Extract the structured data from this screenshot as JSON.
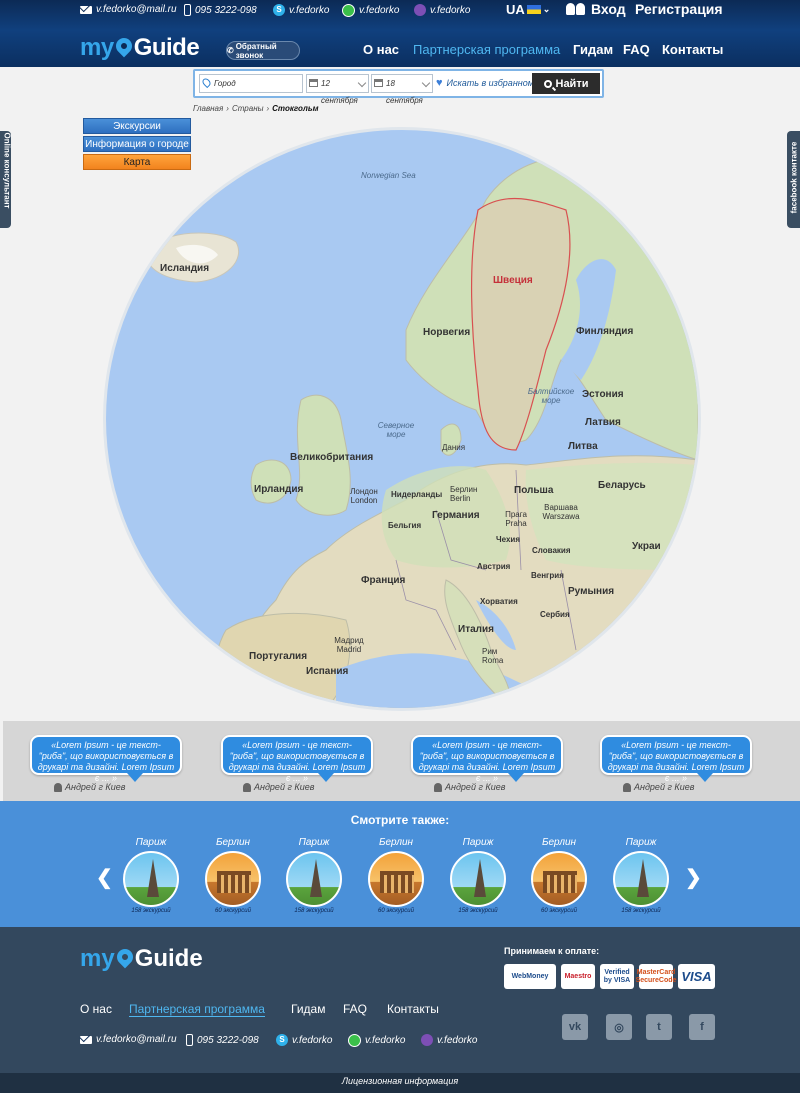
{
  "topbar": {
    "email": "v.fedorko@mail.ru",
    "phone": "095 3222-098",
    "skype": "v.fedorko",
    "whatsapp": "v.fedorko",
    "viber": "v.fedorko",
    "lang": "UA",
    "login": "Вход",
    "register": "Регистрация"
  },
  "header": {
    "logo_my": "my",
    "logo_guide": "Guide",
    "callback": "Обратный звонок",
    "nav": [
      "О нас",
      "Партнерская программа",
      "Гидам",
      "FAQ",
      "Контакты"
    ]
  },
  "search": {
    "city_placeholder": "Город",
    "date_from": "12 сентября",
    "date_to": "18 сентября",
    "favorites": "Искать в избранном",
    "find": "Найти"
  },
  "breadcrumb": [
    "Главная",
    "Страны",
    "Стокгольм"
  ],
  "side_menu": [
    "Экскурсии",
    "Информация о городе",
    "Карта"
  ],
  "side_tabs": {
    "left": "Online консультант",
    "right": "facebook  контакте"
  },
  "map": {
    "labels": {
      "norwegian_sea": "Norwegian Sea",
      "iceland": "Исландия",
      "sweden": "Швеция",
      "norway": "Норвегия",
      "finland": "Финляндия",
      "estonia": "Эстония",
      "baltic_sea": "Балтийское море",
      "latvia": "Латвия",
      "north_sea": "Северное море",
      "denmark": "Дания",
      "lithuania": "Литва",
      "uk": "Великобритания",
      "belarus": "Беларусь",
      "ireland": "Ирландия",
      "london": "Лондон London",
      "netherlands": "Нидерланды",
      "berlin": "Берлин Berlin",
      "poland": "Польша",
      "warsaw": "Варшава Warszawa",
      "belgium": "Бельгия",
      "germany": "Германия",
      "prague": "Прага Praha",
      "czech": "Чехия",
      "ukraine": "Украи",
      "slovakia": "Словакия",
      "austria": "Австрия",
      "hungary": "Венгрия",
      "france": "Франция",
      "croatia": "Хорватия",
      "serbia": "Сербия",
      "romania": "Румыния",
      "italy": "Италия",
      "rome": "Рим Roma",
      "portugal": "Португалия",
      "madrid": "Мадрид Madrid",
      "spain": "Испания"
    }
  },
  "testimonials": [
    {
      "text": "«Lorem Ipsum - це текст-\"риба\", що використовується в друкарі та дизайні. Lorem Ipsum є ... »",
      "author": "Андрей г Киев"
    },
    {
      "text": "«Lorem Ipsum - це текст-\"риба\", що використовується в друкарі та дизайні. Lorem Ipsum є ... »",
      "author": "Андрей г Киев"
    },
    {
      "text": "«Lorem Ipsum - це текст-\"риба\", що використовується в друкарі та дизайні. Lorem Ipsum є ... »",
      "author": "Андрей г Киев"
    },
    {
      "text": "«Lorem Ipsum - це текст-\"риба\", що використовується в друкарі та дизайні. Lorem Ipsum є ... »",
      "author": "Андрей г Киев"
    }
  ],
  "see_also": {
    "title": "Смотрите также:",
    "prev": "❮",
    "next": "❯",
    "cities": [
      {
        "name": "Париж",
        "count": "158 экскурсий",
        "image": "eiffel-tower"
      },
      {
        "name": "Берлин",
        "count": "60 экскурсий",
        "image": "brandenburg-gate"
      },
      {
        "name": "Париж",
        "count": "158 экскурсий",
        "image": "eiffel-tower"
      },
      {
        "name": "Берлин",
        "count": "60 экскурсий",
        "image": "brandenburg-gate"
      },
      {
        "name": "Париж",
        "count": "158 экскурсий",
        "image": "eiffel-tower"
      },
      {
        "name": "Берлин",
        "count": "60 экскурсий",
        "image": "brandenburg-gate"
      },
      {
        "name": "Париж",
        "count": "158 экскурсий",
        "image": "eiffel-tower"
      }
    ]
  },
  "footer": {
    "logo_my": "my",
    "logo_guide": "Guide",
    "nav": [
      "О нас",
      "Партнерская программа",
      "Гидам",
      "FAQ",
      "Контакты"
    ],
    "email": "v.fedorko@mail.ru",
    "phone": "095 3222-098",
    "skype": "v.fedorko",
    "whatsapp": "v.fedorko",
    "viber": "v.fedorko",
    "payment_title": "Принимаем к оплате:",
    "payments": [
      "WebMoney",
      "Maestro",
      "Verified by VISA",
      "MasterCard SecureCode",
      "VISA"
    ],
    "social": [
      "vk",
      "instagram",
      "twitter",
      "facebook"
    ],
    "social_glyphs": [
      "vk",
      "◎",
      "t",
      "f"
    ],
    "license": "Лицензионная информация"
  },
  "colors": {
    "accent": "#4a90d9",
    "orange": "#f2831e",
    "header": "#0c2a55",
    "footer": "#33485e"
  }
}
